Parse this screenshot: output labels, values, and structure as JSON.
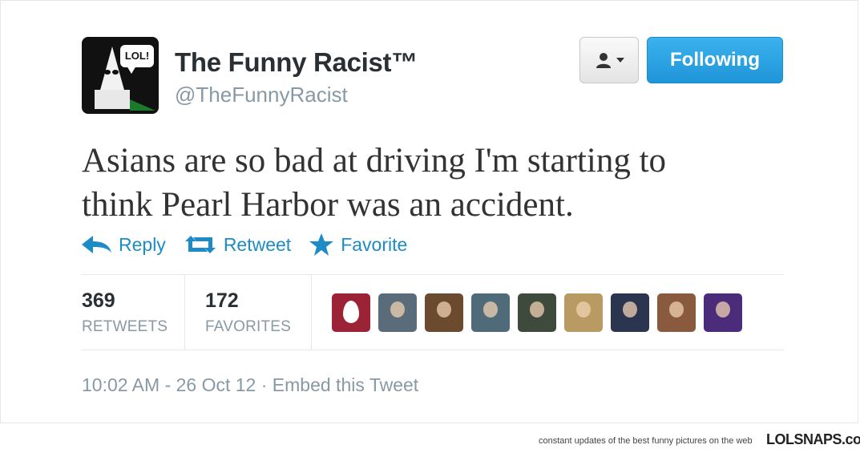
{
  "profile": {
    "name": "The Funny Racist™",
    "handle": "@TheFunnyRacist",
    "avatar_badge": "LOL!"
  },
  "buttons": {
    "user_menu_icon": "person-dropdown-icon",
    "following_label": "Following"
  },
  "tweet": {
    "text_line1": "Asians are so bad at driving I'm starting to",
    "text_line2": "think Pearl Harbor was an accident."
  },
  "actions": {
    "reply": "Reply",
    "retweet": "Retweet",
    "favorite": "Favorite"
  },
  "stats": {
    "retweets_count": "369",
    "retweets_label": "RETWEETS",
    "favorites_count": "172",
    "favorites_label": "FAVORITES"
  },
  "favoriters": [
    {
      "color": "#9b2335"
    },
    {
      "color": "#5a6b7a"
    },
    {
      "color": "#6b4a2e"
    },
    {
      "color": "#4f6a78"
    },
    {
      "color": "#3d4a3c"
    },
    {
      "color": "#b89a62"
    },
    {
      "color": "#2c3550"
    },
    {
      "color": "#8a5a3e"
    },
    {
      "color": "#4b2c7a"
    }
  ],
  "meta": {
    "timestamp": "10:02 AM - 26 Oct 12",
    "separator": "·",
    "embed": "Embed this Tweet"
  },
  "footer": {
    "tagline": "constant updates of the best funny pictures on the web",
    "brand": "LOLSNAPS.com"
  },
  "colors": {
    "accent": "#1d8bc6",
    "follow_button": "#2aa3e3",
    "muted": "#8899a6"
  }
}
